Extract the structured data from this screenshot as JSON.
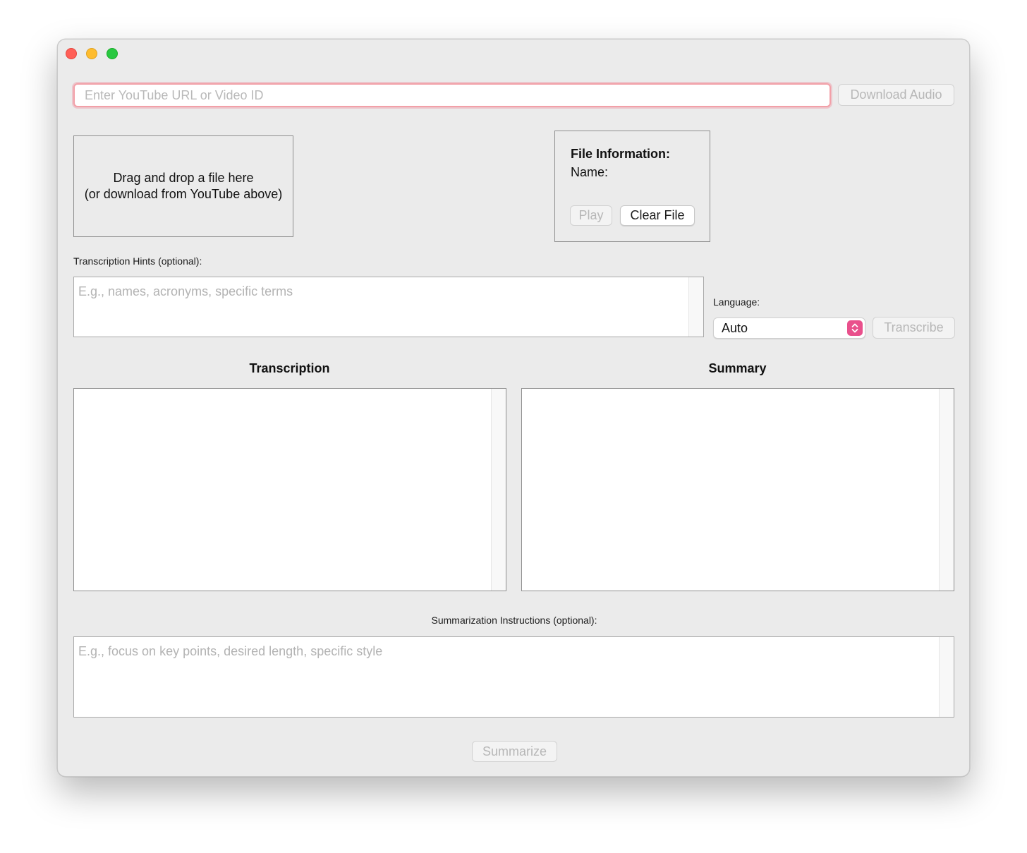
{
  "window": {
    "controls": [
      "close",
      "minimize",
      "zoom"
    ]
  },
  "youtube": {
    "url_placeholder": "Enter YouTube URL or Video ID",
    "url_value": "",
    "download_label": "Download Audio"
  },
  "dropzone": {
    "line1": "Drag and drop a file here",
    "line2": "(or download from YouTube above)"
  },
  "file_info": {
    "title": "File Information:",
    "name_label": "Name:",
    "play_label": "Play",
    "clear_label": "Clear File"
  },
  "hints": {
    "label": "Transcription Hints (optional):",
    "placeholder": "E.g., names, acronyms, specific terms"
  },
  "language": {
    "label": "Language:",
    "selected": "Auto",
    "transcribe_label": "Transcribe"
  },
  "transcription": {
    "title": "Transcription",
    "content": ""
  },
  "summary": {
    "title": "Summary",
    "content": ""
  },
  "instructions": {
    "label": "Summarization Instructions (optional):",
    "placeholder": "E.g., focus on key points, desired length, specific style"
  },
  "summarize_label": "Summarize",
  "colors": {
    "window_bg": "#ebebeb",
    "focus_ring": "#f2a0a8",
    "select_accent": "#e9508c",
    "close": "#ff5f57",
    "minimize": "#febc2e",
    "zoom": "#28c840"
  }
}
